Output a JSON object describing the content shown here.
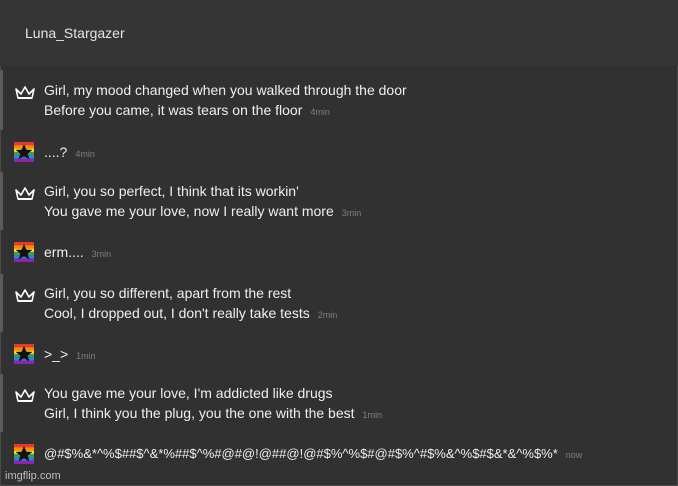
{
  "header": {
    "title": "Luna_Stargazer"
  },
  "messages": [
    {
      "type": "lyric",
      "lines": [
        "Girl, my mood changed when you walked through the door",
        "Before you came, it was tears on the floor"
      ],
      "time": "4min"
    },
    {
      "type": "reply",
      "lines": [
        "....?"
      ],
      "time": "4min"
    },
    {
      "type": "lyric",
      "lines": [
        "Girl, you so perfect, I think that its workin'",
        "You gave me your love, now I really want more"
      ],
      "time": "3min"
    },
    {
      "type": "reply",
      "lines": [
        "erm...."
      ],
      "time": "3min"
    },
    {
      "type": "lyric",
      "lines": [
        "Girl, you so different, apart from the rest",
        "Cool, I dropped out, I don't really take tests"
      ],
      "time": "2min"
    },
    {
      "type": "reply",
      "lines": [
        ">_>"
      ],
      "time": "1min"
    },
    {
      "type": "lyric",
      "lines": [
        "You gave me your love, I'm addicted like drugs",
        "Girl, I think you the plug, you the one with the best"
      ],
      "time": "1min"
    },
    {
      "type": "reply",
      "lines": [
        "@#$%&*^%$##$^&*%##$^%#@#@!@##@!@#$%^%$#@#$%^#$%&^%$#$&*&^%$%*"
      ],
      "time": "now"
    }
  ],
  "footer": {
    "watermark": "imgflip.com"
  },
  "colors": {
    "background": "#313131",
    "header": "#353535",
    "text": "#efefef",
    "timestamp": "#7f7f7f",
    "accent_bar": "#5a5a5a"
  },
  "icons": {
    "lyric_sender": "crown-icon",
    "reply_sender": "rainbow-star-avatar-icon"
  }
}
